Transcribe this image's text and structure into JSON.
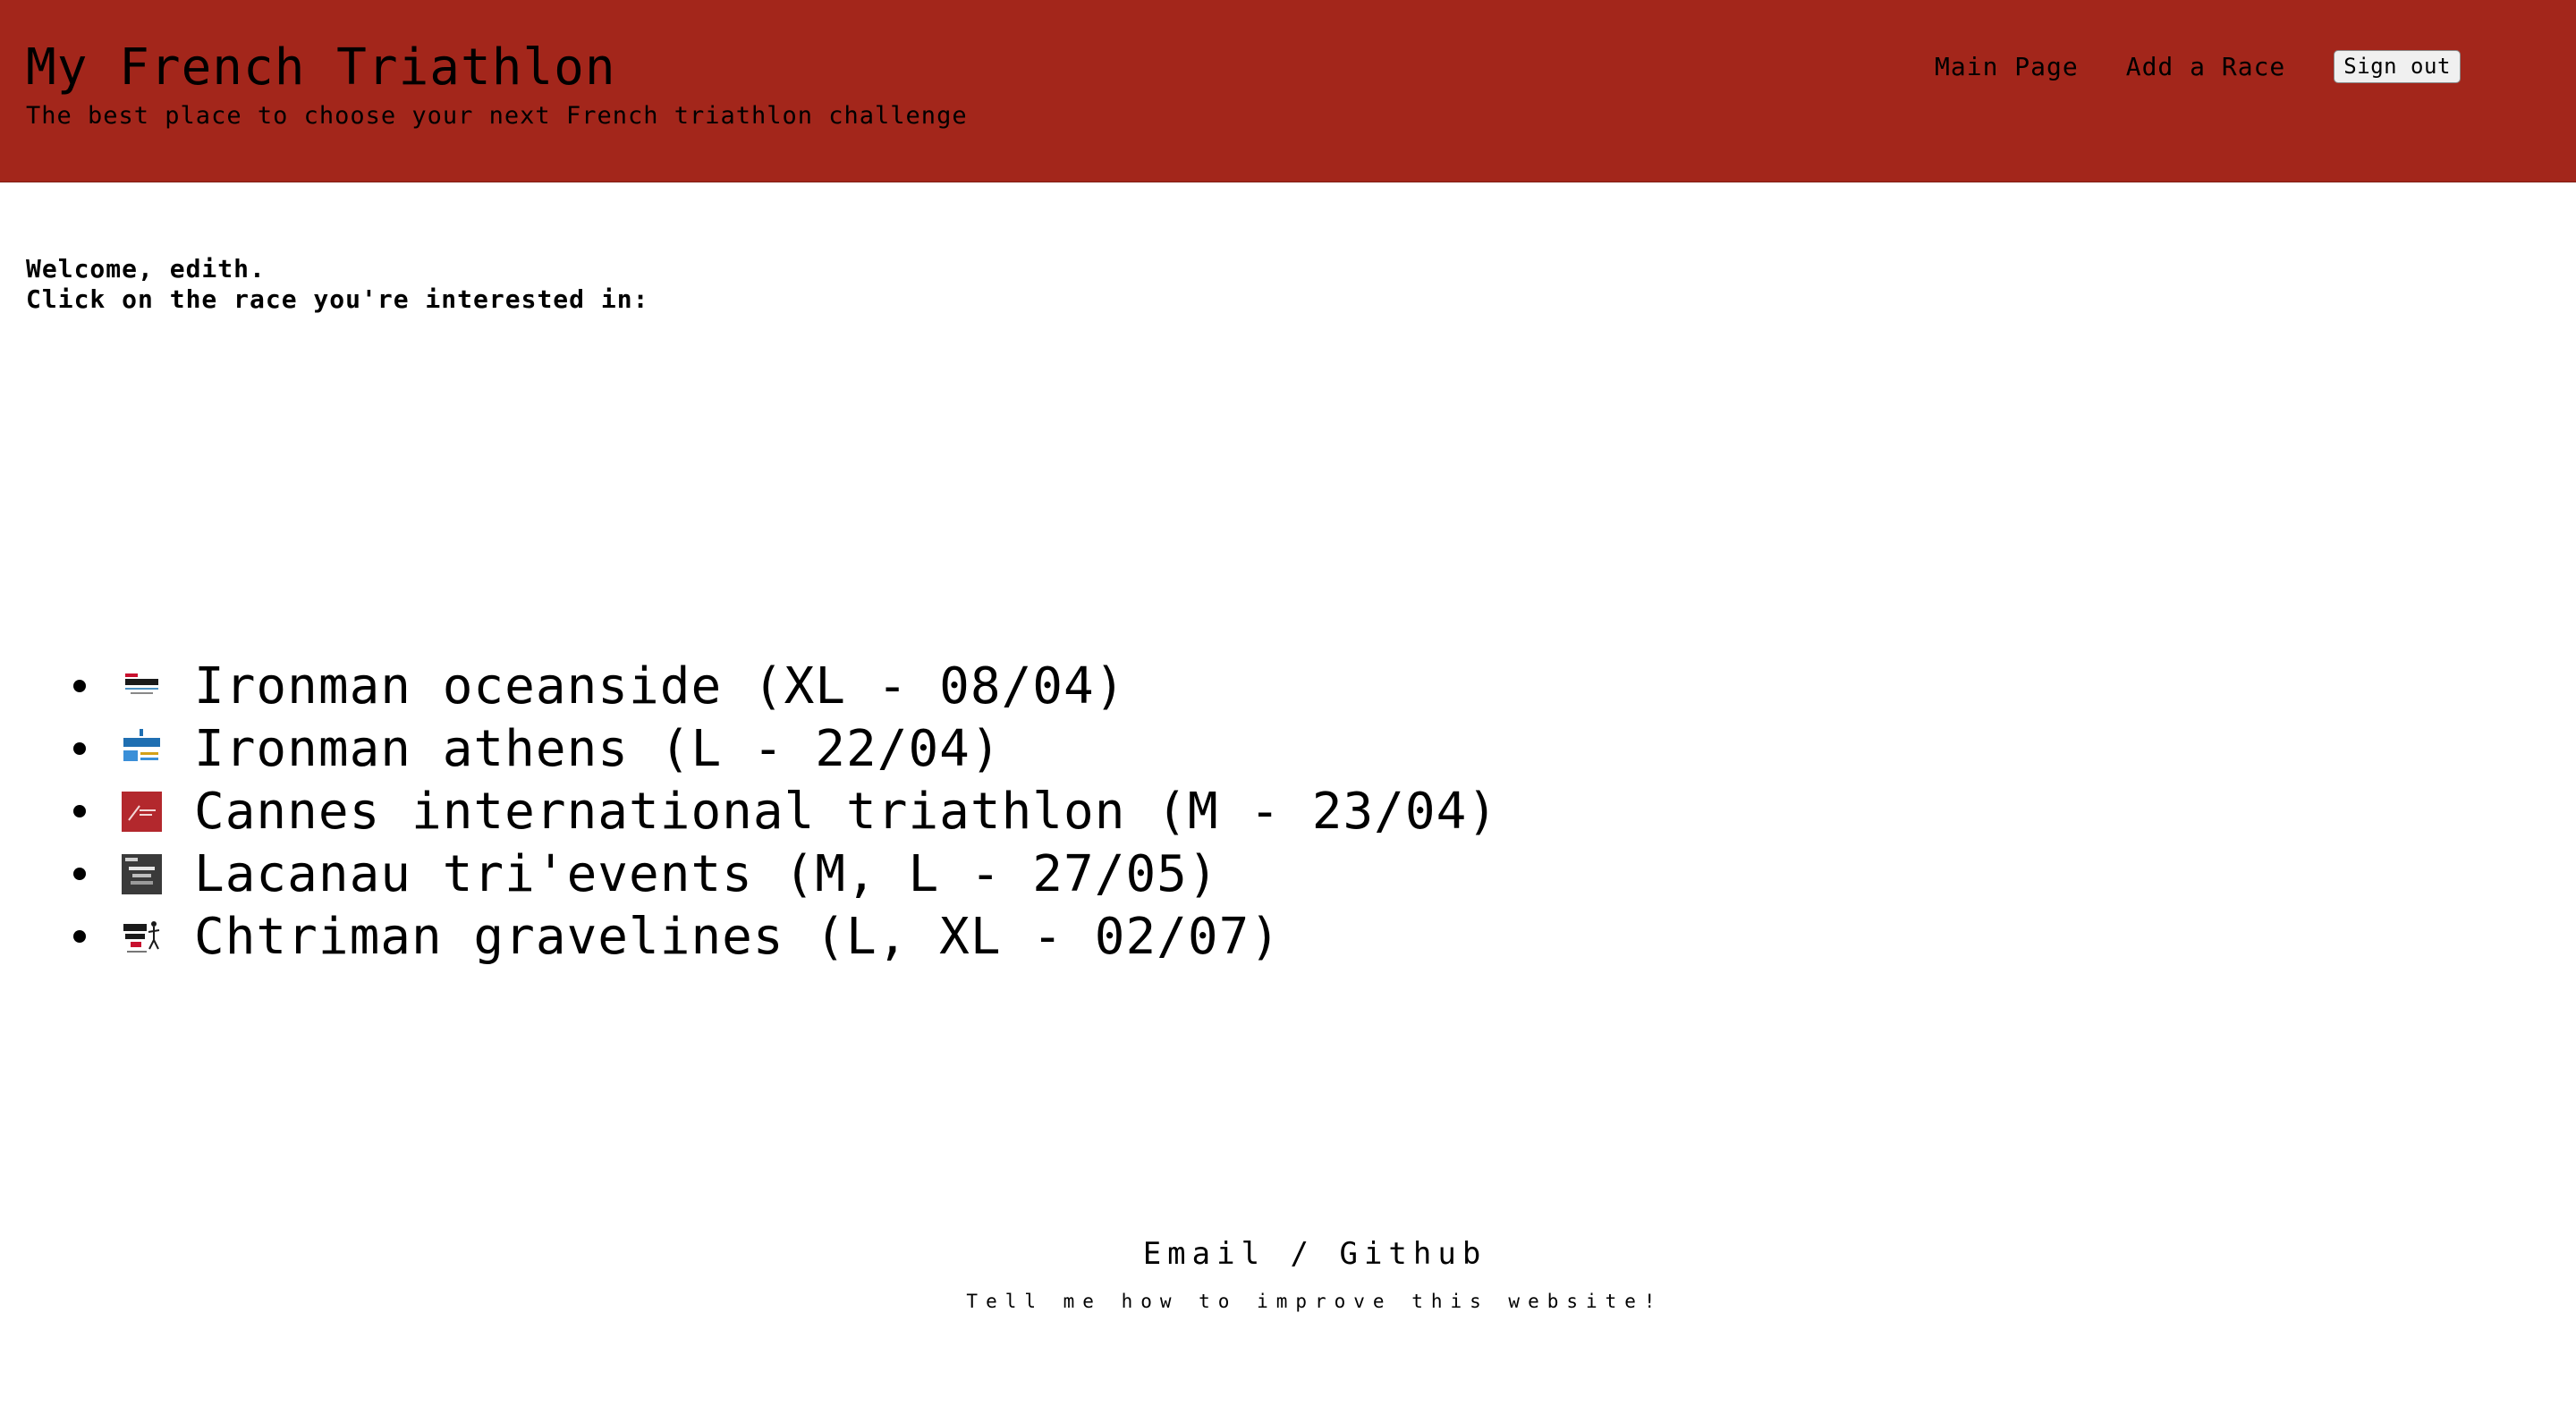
{
  "header": {
    "title": "My French Triathlon",
    "subtitle": "The best place to choose your next French triathlon challenge",
    "background_color": "#a3261b"
  },
  "nav": {
    "main_page": "Main Page",
    "add_race": "Add a Race",
    "sign_out": "Sign out"
  },
  "main": {
    "welcome": "Welcome, edith.",
    "instruction": "Click on the race you're interested in:"
  },
  "races": [
    {
      "label": "Ironman oceanside (XL - 08/04)",
      "logo": "ironman-oceanside-logo"
    },
    {
      "label": "Ironman athens (L - 22/04)",
      "logo": "ironman-athens-logo"
    },
    {
      "label": "Cannes international triathlon (M - 23/04)",
      "logo": "cannes-triathlon-logo"
    },
    {
      "label": "Lacanau tri'events (M, L - 27/05)",
      "logo": "lacanau-trievents-logo"
    },
    {
      "label": "Chtriman gravelines (L, XL - 02/07)",
      "logo": "chtriman-gravelines-logo"
    }
  ],
  "footer": {
    "email": "Email",
    "separator": " / ",
    "github": "Github",
    "note": "Tell me how to improve this website!"
  }
}
